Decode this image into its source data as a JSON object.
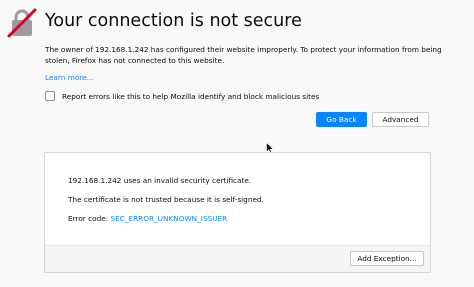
{
  "page": {
    "title": "Your connection is not secure",
    "description": "The owner of 192.168.1.242 has configured their website improperly. To protect your information from being stolen, Firefox has not connected to this website.",
    "learn_more": "Learn more...",
    "report_checkbox_label": "Report errors like this to help Mozilla identify and block malicious sites",
    "report_checked": false
  },
  "buttons": {
    "go_back": "Go Back",
    "advanced": "Advanced",
    "add_exception": "Add Exception..."
  },
  "advanced": {
    "line1": "192.168.1.242 uses an invalid security certificate.",
    "line2": "The certificate is not trusted because it is self-signed.",
    "error_code_label": "Error code: ",
    "error_code": "SEC_ERROR_UNKNOWN_ISSUER"
  },
  "icons": {
    "warning_lock": "broken-lock-icon",
    "cursor": "mouse-pointer-icon"
  },
  "colors": {
    "accent": "#0a84ff",
    "warning": "#d70022",
    "background": "#f9f9fa"
  }
}
